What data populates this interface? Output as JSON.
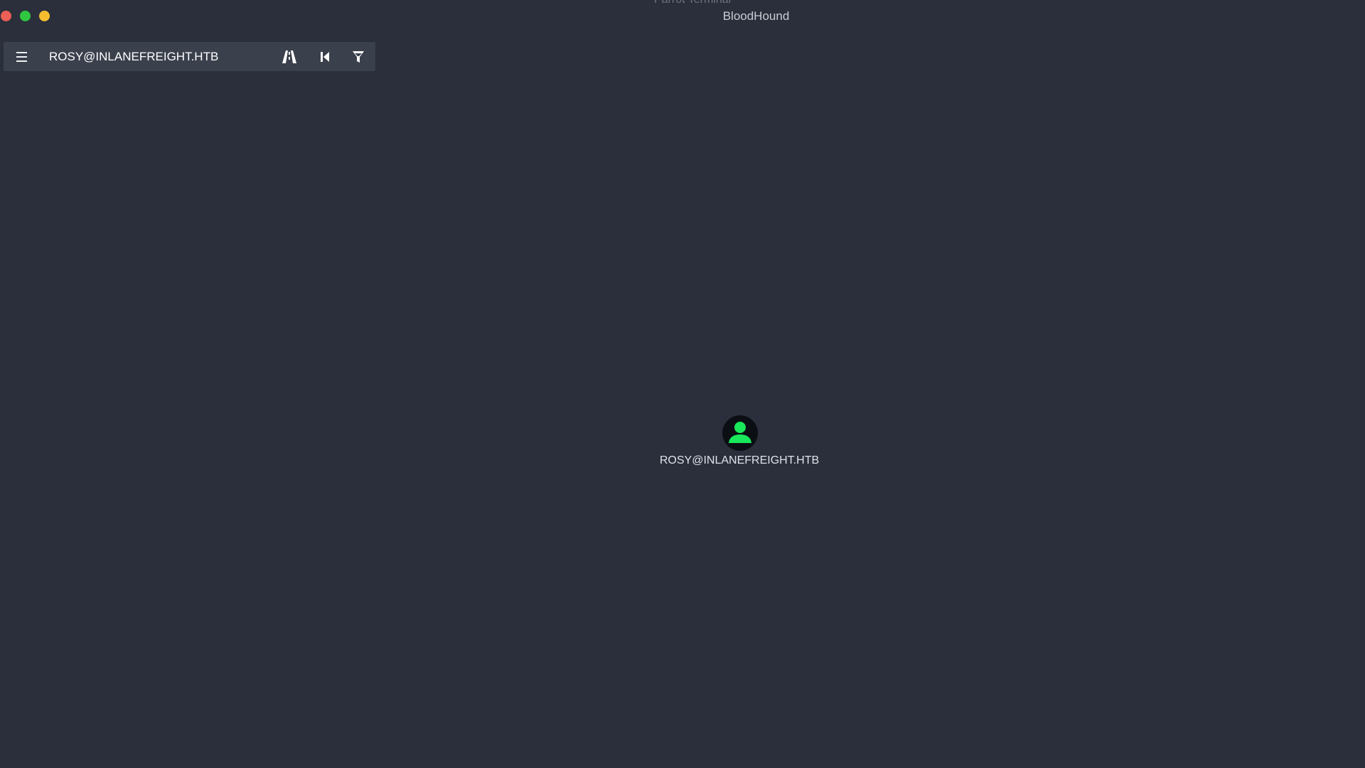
{
  "window": {
    "background_title": "Parrot Terminal",
    "title": "BloodHound",
    "controls": {
      "close_color": "#ec5f56",
      "maximize_color": "#2fc640",
      "minimize_color": "#f4be2f"
    }
  },
  "toolbar": {
    "menu_icon": "hamburger-menu-icon",
    "search_value": "ROSY@INLANEFREIGHT.HTB",
    "icons": [
      "road-pathfinding-icon",
      "step-backward-icon",
      "filter-icon"
    ]
  },
  "graph": {
    "nodes": [
      {
        "label": "ROSY@INLANEFREIGHT.HTB",
        "type": "user",
        "icon": "user-icon",
        "color": "#18e85a"
      }
    ]
  },
  "colors": {
    "background": "#2a2f3b",
    "toolbar": "#3a404c",
    "accent": "#18e85a"
  }
}
